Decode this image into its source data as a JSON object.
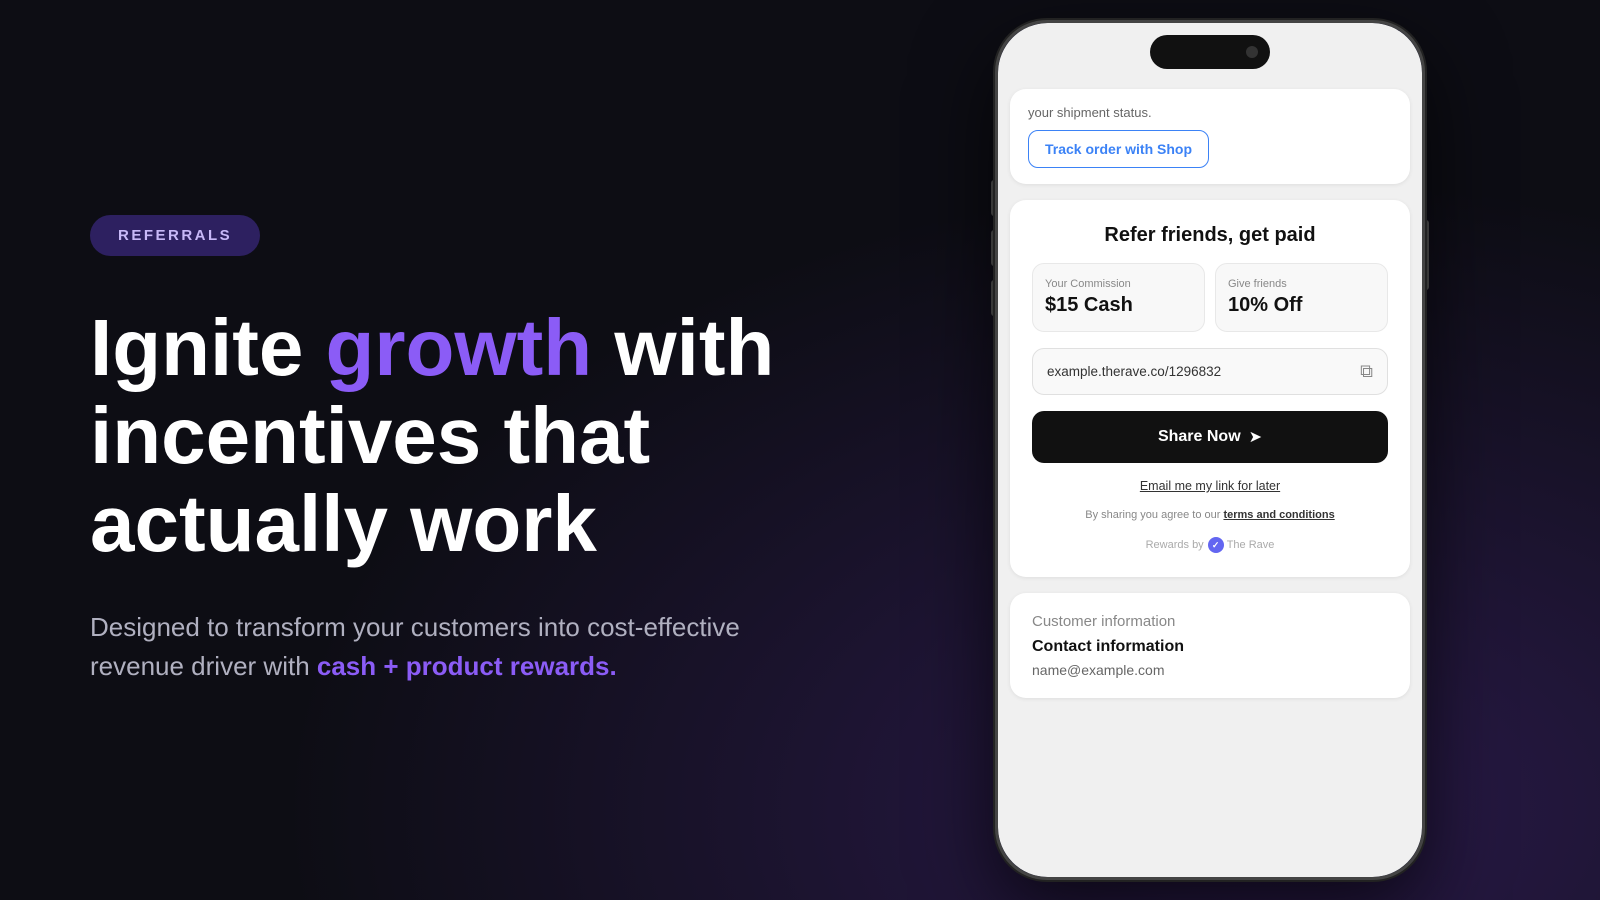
{
  "badge": {
    "text": "REFERRALS"
  },
  "headline": {
    "part1": "Ignite ",
    "accent": "growth",
    "part2": " with incentives that actually work"
  },
  "subtext": {
    "part1": "Designed to transform your customers into cost-effective revenue driver with ",
    "accent": "cash + product rewards."
  },
  "phone": {
    "track_status": "your shipment status.",
    "track_button": "Track order with Shop",
    "referral": {
      "title": "Refer friends, get paid",
      "commission_label": "Your Commission",
      "commission_value": "$15 Cash",
      "friends_label": "Give friends",
      "friends_value": "10% Off",
      "link": "example.therave.co/1296832",
      "share_button": "Share Now",
      "email_link": "Email me my link for later",
      "terms_prefix": "By sharing you agree to our ",
      "terms_link": "terms and conditions",
      "powered_prefix": "Rewards by ",
      "powered_brand": "The Rave"
    },
    "customer": {
      "section_title": "Customer information",
      "sub_title": "Contact information",
      "email_placeholder": "name@example.com"
    }
  }
}
